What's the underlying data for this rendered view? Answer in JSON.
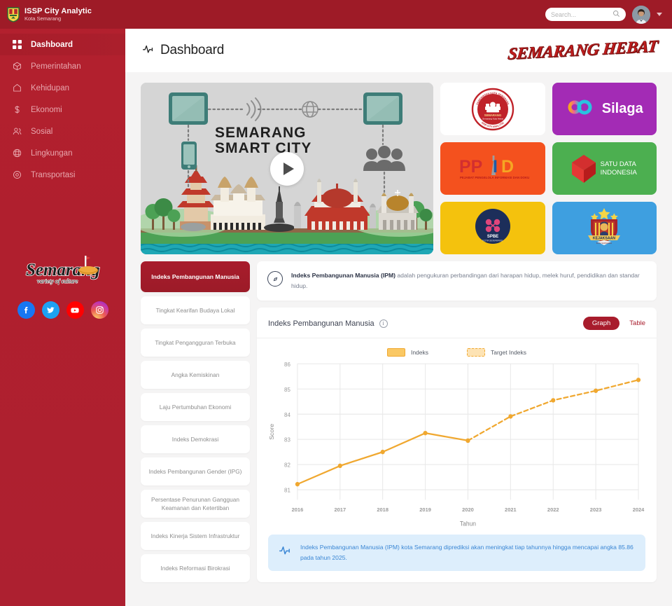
{
  "brand": {
    "title": "ISSP City Analytic",
    "subtitle": "Kota Semarang",
    "crest_icon": "semarang-crest-icon"
  },
  "topbar": {
    "search_placeholder": "Search...",
    "search_value": "",
    "search_icon": "search-icon",
    "avatar_icon": "user-avatar",
    "caret_icon": "chevron-down-icon"
  },
  "sidebar": {
    "items": [
      {
        "label": "Dashboard",
        "icon": "grid-icon",
        "active": true
      },
      {
        "label": "Pemerintahan",
        "icon": "box-icon",
        "active": false
      },
      {
        "label": "Kehidupan",
        "icon": "home-icon",
        "active": false
      },
      {
        "label": "Ekonomi",
        "icon": "dollar-icon",
        "active": false
      },
      {
        "label": "Sosial",
        "icon": "users-icon",
        "active": false
      },
      {
        "label": "Lingkungan",
        "icon": "globe-icon",
        "active": false
      },
      {
        "label": "Transportasi",
        "icon": "location-icon",
        "active": false
      }
    ],
    "logo_text": "Semarang",
    "logo_tagline": "variety of culture",
    "socials": [
      {
        "name": "facebook",
        "glyph": "f"
      },
      {
        "name": "twitter",
        "glyph": "t"
      },
      {
        "name": "youtube",
        "glyph": "y"
      },
      {
        "name": "instagram",
        "glyph": "i"
      }
    ]
  },
  "page": {
    "title": "Dashboard",
    "title_icon": "pulse-icon",
    "logo_hebat": "SEMARANG HEBAT"
  },
  "banner": {
    "line1": "SEMARANG",
    "line2": "SMART CITY",
    "play_icon": "play-icon"
  },
  "tiles": [
    {
      "name": "semarang-satu-data",
      "label": "",
      "bg": "#ffffff",
      "kind": "crest"
    },
    {
      "name": "silaga",
      "label": "Silaga",
      "bg": "#a32bb5",
      "kind": "silaga"
    },
    {
      "name": "ppid",
      "label": "PPID",
      "bg": "#f4511e",
      "kind": "ppid"
    },
    {
      "name": "satu-data-indonesia",
      "label": "SATU DATA INDONESIA",
      "bg": "#4caf50",
      "kind": "satudata"
    },
    {
      "name": "spbe",
      "label": "SPBE",
      "bg": "#f4c20d",
      "kind": "spbe"
    },
    {
      "name": "kejaksaan",
      "label": "",
      "bg": "#3e9fe0",
      "kind": "kejaksaan"
    }
  ],
  "index_list": [
    {
      "label": "Indeks Pembangunan Manusia",
      "active": true
    },
    {
      "label": "Tingkat Kearifan Budaya Lokal",
      "active": false
    },
    {
      "label": "Tingkat Pengangguran Terbuka",
      "active": false
    },
    {
      "label": "Angka Kemiskinan",
      "active": false
    },
    {
      "label": "Laju Pertumbuhan Ekonomi",
      "active": false
    },
    {
      "label": "Indeks Demokrasi",
      "active": false
    },
    {
      "label": "Indeks Pembangunan Gender (IPG)",
      "active": false
    },
    {
      "label": "Persentase Penurunan Gangguan Keamanan dan Ketertiban",
      "active": false
    },
    {
      "label": "Indeks Kinerja Sistem Infrastruktur",
      "active": false
    },
    {
      "label": "Indeks Reformasi Birokrasi",
      "active": false
    }
  ],
  "description": {
    "icon": "compass-icon",
    "bold": "Indeks Pembangunan Manusia (IPM)",
    "rest": " adalah pengukuran perbandingan dari harapan hidup, melek huruf, pendidikan dan standar hidup."
  },
  "chart_panel": {
    "title": "Indeks Pembangunan Manusia",
    "info_icon": "info-icon",
    "toggle_graph": "Graph",
    "toggle_table": "Table",
    "active_toggle": "Graph"
  },
  "note": {
    "icon": "pulse-icon",
    "text": "Indeks Pembangunan Manusia (IPM) kota Semarang diprediksi akan meningkat tiap tahunnya hingga mencapai angka 85.86 pada tahun 2025."
  },
  "colors": {
    "brand_red": "#a81c2c",
    "sidebar_red": "#b0202e",
    "topbar_red": "#9e1b27",
    "chart_orange": "#f0a830",
    "note_blue": "#3a86d4",
    "note_bg": "#ddeefc"
  },
  "chart_data": {
    "type": "line",
    "title": "Indeks Pembangunan Manusia",
    "xlabel": "Tahun",
    "ylabel": "Score",
    "categories": [
      "2016",
      "2017",
      "2018",
      "2019",
      "2020",
      "2021",
      "2022",
      "2023",
      "2024"
    ],
    "ylim": [
      80.6,
      86.0
    ],
    "yticks": [
      81,
      82,
      83,
      84,
      85,
      86
    ],
    "grid": true,
    "legend_position": "top-center",
    "series": [
      {
        "name": "Indeks",
        "style": "solid",
        "color": "#f0a830",
        "x": [
          "2016",
          "2017",
          "2018",
          "2019",
          "2020"
        ],
        "values": [
          81.22,
          81.95,
          82.5,
          83.25,
          82.95
        ]
      },
      {
        "name": "Target Indeks",
        "style": "dashed",
        "color": "#f0a830",
        "x": [
          "2020",
          "2021",
          "2022",
          "2023",
          "2024"
        ],
        "values": [
          82.95,
          83.91,
          84.55,
          84.93,
          85.36
        ]
      }
    ]
  }
}
